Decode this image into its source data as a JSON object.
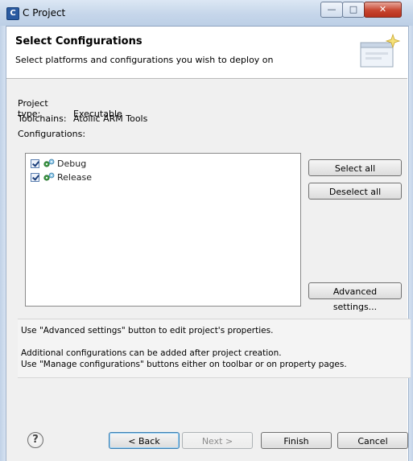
{
  "window": {
    "app_icon_glyph": "C",
    "title": "C Project",
    "min_glyph": "—",
    "max_glyph": "□",
    "close_glyph": "✕"
  },
  "header": {
    "title": "Select Configurations",
    "description": "Select platforms and configurations you wish to deploy on",
    "icon": "wizard-banner-icon"
  },
  "project_info": {
    "project_type_label": "Project type:",
    "project_type_value": "Executable",
    "toolchains_label": "Toolchains:",
    "toolchains_value": "Atollic ARM Tools",
    "configurations_label": "Configurations:"
  },
  "configurations": [
    {
      "name": "Debug",
      "checked": true,
      "icon": "gear-config-icon"
    },
    {
      "name": "Release",
      "checked": true,
      "icon": "gear-config-icon"
    }
  ],
  "side_buttons": {
    "select_all": "Select all",
    "deselect_all": "Deselect all",
    "advanced_settings": "Advanced settings..."
  },
  "messages": {
    "line1": "Use \"Advanced settings\" button to edit project's properties.",
    "line2": "Additional configurations can be added after project creation.",
    "line3": "Use \"Manage configurations\" buttons either on toolbar or on property pages."
  },
  "footer": {
    "help_glyph": "?",
    "back": "< Back",
    "next": "Next >",
    "finish": "Finish",
    "cancel": "Cancel"
  },
  "colors": {
    "titlebar": "#c6d6ea",
    "close_button": "#c7452f",
    "panel_background": "#f0f0f0",
    "default_button_border": "#3c7fb1"
  }
}
